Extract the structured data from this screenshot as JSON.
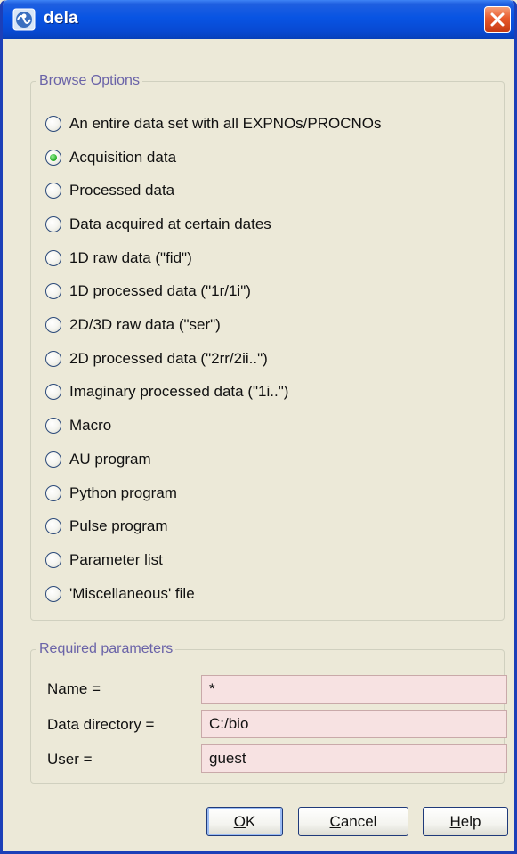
{
  "window": {
    "title": "dela",
    "app_icon": "bruker-topspin-icon",
    "close_icon": "close-icon"
  },
  "browse_options": {
    "legend": "Browse Options",
    "selected_index": 1,
    "options": [
      {
        "label": "An entire data set with all EXPNOs/PROCNOs",
        "checked": false
      },
      {
        "label": "Acquisition data",
        "checked": true
      },
      {
        "label": "Processed data",
        "checked": false
      },
      {
        "label": "Data acquired at certain dates",
        "checked": false
      },
      {
        "label": "1D raw data (\"fid\")",
        "checked": false
      },
      {
        "label": "1D processed data (\"1r/1i\")",
        "checked": false
      },
      {
        "label": "2D/3D raw data (\"ser\")",
        "checked": false
      },
      {
        "label": "2D processed data (\"2rr/2ii..\")",
        "checked": false
      },
      {
        "label": "Imaginary processed data (\"1i..\")",
        "checked": false
      },
      {
        "label": "Macro",
        "checked": false
      },
      {
        "label": "AU program",
        "checked": false
      },
      {
        "label": "Python program",
        "checked": false
      },
      {
        "label": "Pulse program",
        "checked": false
      },
      {
        "label": "Parameter list",
        "checked": false
      },
      {
        "label": "'Miscellaneous' file",
        "checked": false
      }
    ]
  },
  "required_parameters": {
    "legend": "Required parameters",
    "fields": [
      {
        "label": "Name =",
        "value": "*"
      },
      {
        "label": "Data directory =",
        "value": "C:/bio"
      },
      {
        "label": "User =",
        "value": "guest"
      }
    ]
  },
  "buttons": {
    "ok": {
      "mnemonic": "O",
      "rest": "K"
    },
    "cancel": {
      "mnemonic": "C",
      "rest": "ancel"
    },
    "help": {
      "mnemonic": "H",
      "rest": "elp"
    }
  },
  "colors": {
    "titlebar": "#0854e3",
    "field_background": "#f7e2e2",
    "legend_text": "#6a63a8",
    "radio_selected": "#2cb52c"
  }
}
